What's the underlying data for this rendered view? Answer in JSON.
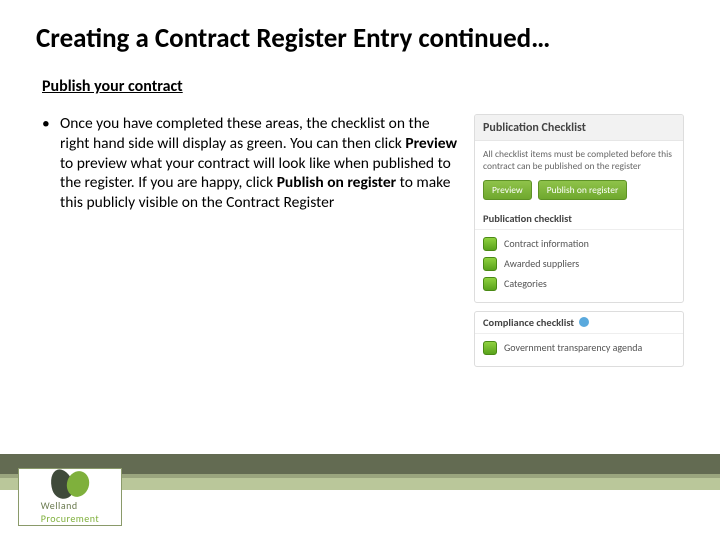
{
  "title": "Creating a Contract Register Entry continued…",
  "subheading": "Publish your contract",
  "bullet": "•",
  "para": {
    "p1": "Once you have completed these areas, the checklist on the right hand side will display as green. You can then click ",
    "b1": "Preview",
    "p2": " to preview what your contract will look like when published to the register. If you are happy, click ",
    "b2": "Publish on register",
    "p3": " to make this publicly visible on the Contract Register"
  },
  "panel1": {
    "header": "Publication Checklist",
    "note": "All checklist items must be completed before this contract can be published on the register",
    "btnPreview": "Preview",
    "btnPublish": "Publish on register",
    "subHeader": "Publication checklist",
    "items": [
      "Contract information",
      "Awarded suppliers",
      "Categories"
    ]
  },
  "panel2": {
    "header": "Compliance checklist",
    "item": "Government transparency agenda"
  },
  "logo": {
    "line1": "Welland",
    "line2": "Procurement"
  }
}
